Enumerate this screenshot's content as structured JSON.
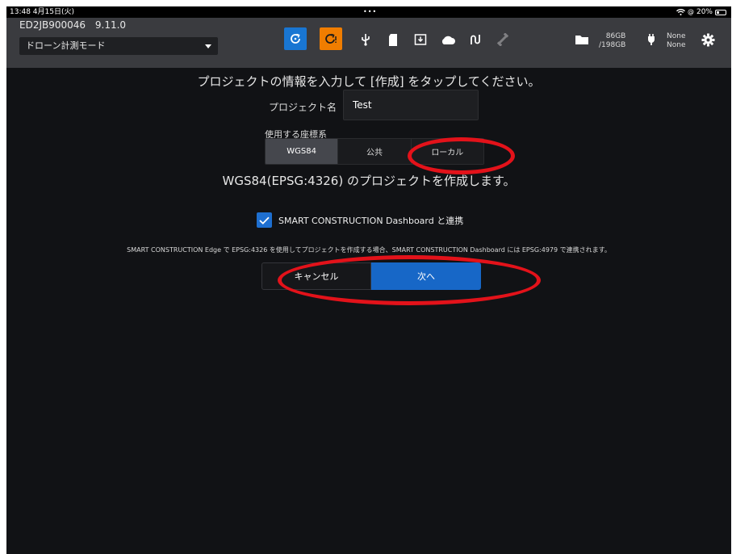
{
  "status_bar": {
    "time": "13:48  4月15日(火)",
    "dots": "•••",
    "wifi_icon": "wifi-icon",
    "battery_text": "20%"
  },
  "header": {
    "device_id": "ED2JB900046",
    "version": "9.11.0",
    "mode_select": "ドローン計測モード",
    "storage_used": "86GB",
    "storage_total": "/198GB",
    "power_none_1": "None",
    "power_none_2": "None",
    "icons": [
      "refresh-icon",
      "refresh-alert-icon",
      "usb-icon",
      "sd-card-icon",
      "download-icon",
      "cloud-icon",
      "signal-icon",
      "satellite-icon",
      "folder-icon",
      "plug-icon",
      "gear-icon"
    ],
    "colors": {
      "refresh_bg": "#1976d2",
      "refresh_alert_bg": "#f07d00",
      "bar_bg": "#3a3b3f"
    }
  },
  "main": {
    "instruction": "プロジェクトの情報を入力して [作成] をタップしてください。",
    "project_name_label": "プロジェクト名",
    "project_name_value": "Test",
    "coord_system_label": "使用する座標系",
    "coord_options": [
      "WGS84",
      "公共",
      "ローカル"
    ],
    "coord_selected": "WGS84",
    "create_message": "WGS84(EPSG:4326) のプロジェクトを作成します。",
    "dashboard_link_label": "SMART CONSTRUCTION Dashboard と連携",
    "dashboard_link_checked": true,
    "note": "SMART CONSTRUCTION Edge で EPSG:4326 を使用してプロジェクトを作成する場合、SMART CONSTRUCTION Dashboard には EPSG:4979 で連携されます。",
    "cancel_label": "キャンセル",
    "next_label": "次へ"
  }
}
